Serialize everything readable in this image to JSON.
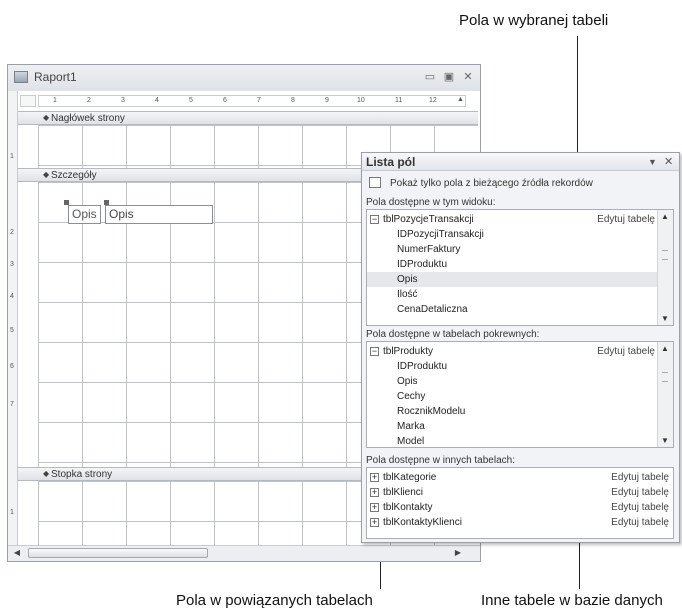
{
  "callouts": {
    "fields_selected_table": "Pola w wybranej tabeli",
    "fields_related_tables": "Pola w powiązanych tabelach",
    "other_tables": "Inne tabele w bazie danych"
  },
  "report_window": {
    "title": "Raport1",
    "minimize": "▭",
    "maximize": "▣",
    "close": "✕",
    "ruler_ticks": [
      "1",
      "2",
      "3",
      "4",
      "5",
      "6",
      "7",
      "8",
      "9",
      "10",
      "11",
      "12"
    ],
    "vertical_ticks": [
      "1",
      "2",
      "3",
      "4",
      "5",
      "6",
      "7",
      "1"
    ],
    "sections": {
      "header": "Nagłówek strony",
      "detail": "Szczegóły",
      "footer": "Stopka strony"
    },
    "controls": {
      "label": "Opis",
      "textbox": "Opis"
    }
  },
  "field_list": {
    "title": "Lista pól",
    "dropdown": "▼",
    "close": "✕",
    "show_only": "Pokaż tylko pola z bieżącego źródła rekordów",
    "available_header": "Pola dostępne w tym widoku:",
    "related_header": "Pola dostępne w tabelach pokrewnych:",
    "other_header": "Pola dostępne w innych tabelach:",
    "edit_label": "Edytuj tabelę",
    "available_table": "tblPozycjeTransakcji",
    "available_fields": [
      "IDPozycjiTransakcji",
      "NumerFaktury",
      "IDProduktu",
      "Opis",
      "Ilość",
      "CenaDetaliczna"
    ],
    "selected_field": "Opis",
    "related_table": "tblProdukty",
    "related_fields": [
      "IDProduktu",
      "Opis",
      "Cechy",
      "RocznikModelu",
      "Marka",
      "Model"
    ],
    "other_tables": [
      "tblKategorie",
      "tblKlienci",
      "tblKontakty",
      "tblKontaktyKlienci"
    ]
  }
}
